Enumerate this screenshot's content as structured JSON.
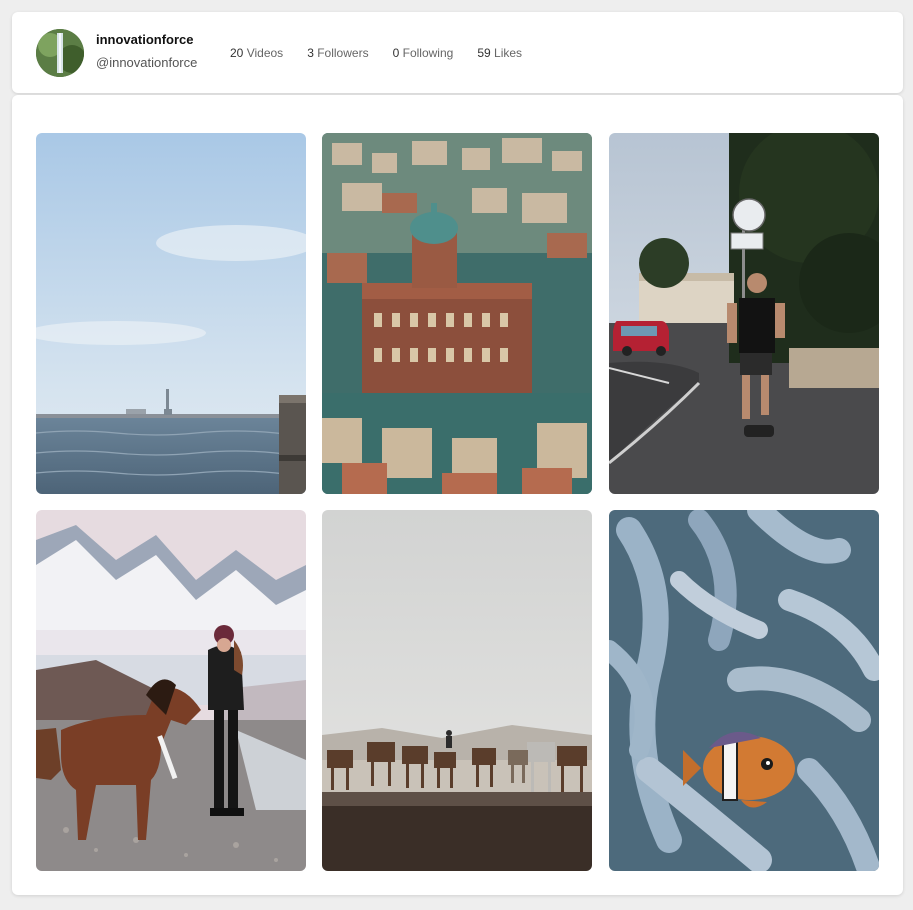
{
  "profile": {
    "username": "innovationforce",
    "handle": "@innovationforce",
    "stats": [
      {
        "value": "20",
        "label": "Videos"
      },
      {
        "value": "3",
        "label": "Followers"
      },
      {
        "value": "0",
        "label": "Following"
      },
      {
        "value": "59",
        "label": "Likes"
      }
    ]
  },
  "videos": [
    {
      "subject": "statue-of-liberty-harbor-view"
    },
    {
      "subject": "aerial-old-city-domed-building"
    },
    {
      "subject": "man-skateboarding-street"
    },
    {
      "subject": "woman-with-horse-mountains"
    },
    {
      "subject": "horse-herd-dusty-plain"
    },
    {
      "subject": "clownfish-in-anemone"
    }
  ]
}
